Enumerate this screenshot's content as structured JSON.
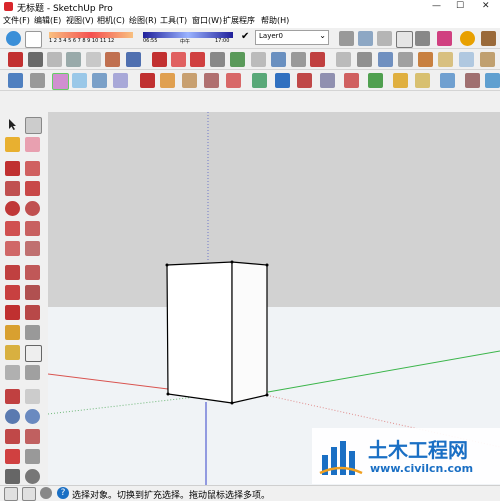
{
  "window": {
    "title": "无标题 - SketchUp Pro"
  },
  "menu": [
    "文件(F)",
    "编辑(E)",
    "视图(V)",
    "相机(C)",
    "绘图(R)",
    "工具(T)",
    "窗口(W)",
    "扩展程序",
    "帮助(H)"
  ],
  "shadow_slider": {
    "month_ticks": "1 2 3 4 5 6 7 8 9 10 11 12",
    "time_start": "06:55",
    "time_mid": "中午",
    "time_end": "17:00"
  },
  "layer": {
    "name": "Layer0",
    "check": "✔"
  },
  "status": {
    "message": "选择对象。切换到扩充选择。拖动鼠标选择多项。"
  },
  "watermark": {
    "title": "土木工程网",
    "url": "www.civilcn.com"
  },
  "colors": {
    "sky": "#d2d2d2",
    "ground": "#f0f3f6",
    "red_axis": "#d9534f",
    "green_axis": "#3bb54a",
    "blue_axis": "#3340c9",
    "watermark_blue": "#1a6fc4"
  }
}
